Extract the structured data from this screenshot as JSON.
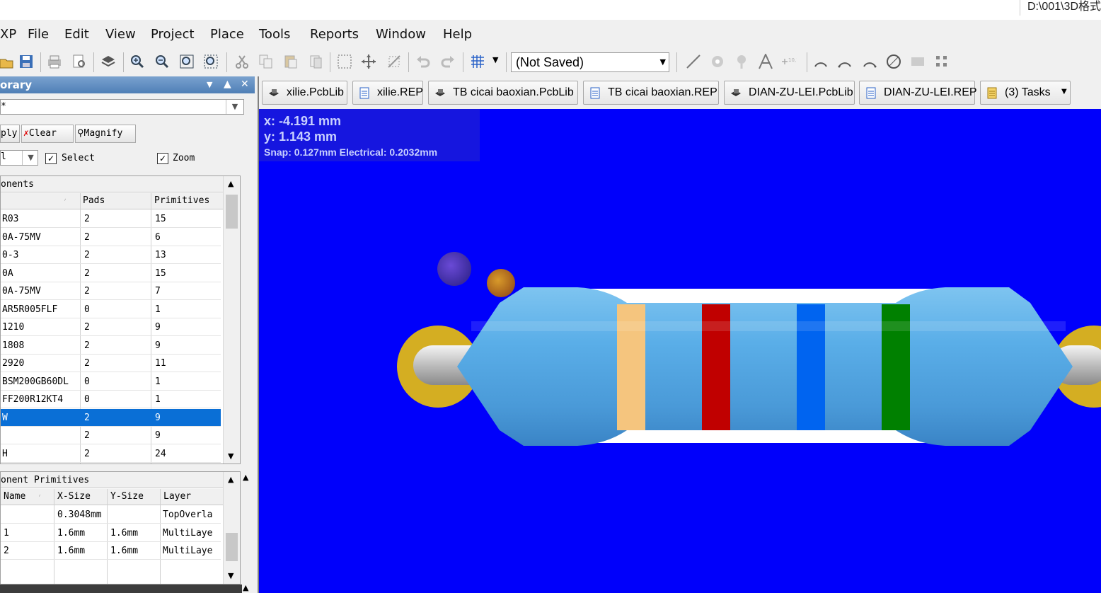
{
  "window": {
    "title_path": "D:\\001\\3D格式"
  },
  "menu": [
    "XP",
    "File",
    "Edit",
    "View",
    "Project",
    "Place",
    "Tools",
    "Reports",
    "Window",
    "Help"
  ],
  "toolbar": {
    "design_view": "(Not Saved)",
    "icons": [
      "open-icon",
      "save-icon",
      "print-icon",
      "print-preview-icon",
      "layer-icon",
      "zoom-in-icon",
      "zoom-out-icon",
      "zoom-fit-icon",
      "zoom-selection-icon",
      "cut-icon",
      "copy-icon",
      "paste-icon",
      "rubber-stamp-icon",
      "select-area-icon",
      "move-icon",
      "deselect-icon",
      "undo-icon",
      "redo-icon",
      "grid-icon",
      "line-icon",
      "pad-icon",
      "via-icon",
      "string-icon",
      "coordinate-icon",
      "arc-center-icon",
      "arc-edge-icon",
      "arc-any-icon",
      "circle-icon",
      "fill-icon",
      "array-icon"
    ]
  },
  "panel": {
    "title": "orary",
    "mask_value": "*",
    "buttons": {
      "apply": "ply",
      "clear": "Clear",
      "magnify": "Magnify"
    },
    "filter_value": "l",
    "select_label": "Select",
    "select_checked": true,
    "zoom_label": "Zoom",
    "zoom_checked": true,
    "components": {
      "title": "onents",
      "columns": [
        "",
        "Pads",
        "Primitives"
      ],
      "rows": [
        {
          "name": "R03",
          "pads": "2",
          "primitives": "15"
        },
        {
          "name": "0A-75MV",
          "pads": "2",
          "primitives": "6"
        },
        {
          "name": "0-3",
          "pads": "2",
          "primitives": "13"
        },
        {
          "name": "0A",
          "pads": "2",
          "primitives": "15"
        },
        {
          "name": "0A-75MV",
          "pads": "2",
          "primitives": "7"
        },
        {
          "name": "AR5R005FLF",
          "pads": "0",
          "primitives": "1"
        },
        {
          "name": "1210",
          "pads": "2",
          "primitives": "9"
        },
        {
          "name": "1808",
          "pads": "2",
          "primitives": "9"
        },
        {
          "name": "2920",
          "pads": "2",
          "primitives": "11"
        },
        {
          "name": "BSM200GB60DL",
          "pads": "0",
          "primitives": "1"
        },
        {
          "name": "FF200R12KT4",
          "pads": "0",
          "primitives": "1"
        },
        {
          "name": "W",
          "pads": "2",
          "primitives": "9",
          "selected": true
        },
        {
          "name": "",
          "pads": "2",
          "primitives": "9"
        },
        {
          "name": "H",
          "pads": "2",
          "primitives": "24"
        }
      ]
    },
    "primitives": {
      "title": "onent Primitives",
      "columns": [
        "Name",
        "X-Size",
        "Y-Size",
        "Layer"
      ],
      "rows": [
        {
          "name": "",
          "xsize": "0.3048mm",
          "ysize": "",
          "layer": "TopOverla"
        },
        {
          "name": "1",
          "xsize": "1.6mm",
          "ysize": "1.6mm",
          "layer": "MultiLaye"
        },
        {
          "name": "2",
          "xsize": "1.6mm",
          "ysize": "1.6mm",
          "layer": "MultiLaye"
        }
      ]
    }
  },
  "tabs": [
    {
      "label": "xilie.PcbLib",
      "icon": "pcblib-icon"
    },
    {
      "label": "xilie.REP",
      "icon": "report-icon"
    },
    {
      "label": "TB cicai baoxian.PcbLib",
      "icon": "pcblib-icon"
    },
    {
      "label": "TB cicai baoxian.REP",
      "icon": "report-icon"
    },
    {
      "label": "DIAN-ZU-LEI.PcbLib",
      "icon": "pcblib-icon"
    },
    {
      "label": "DIAN-ZU-LEI.REP",
      "icon": "report-icon"
    },
    {
      "label": "(3) Tasks",
      "icon": "tasks-icon"
    }
  ],
  "viewport": {
    "x_readout": "x: -4.191 mm",
    "y_readout": "y:  1.143 mm",
    "snap_readout": "Snap: 0.127mm Electrical: 0.2032mm",
    "background_color": "#0000fb",
    "resistor_body_color": "#5aaee8",
    "band_colors": [
      "#f5c57e",
      "#c00000",
      "#0064f0",
      "#008000"
    ],
    "pad_color": "#d4ae22"
  }
}
